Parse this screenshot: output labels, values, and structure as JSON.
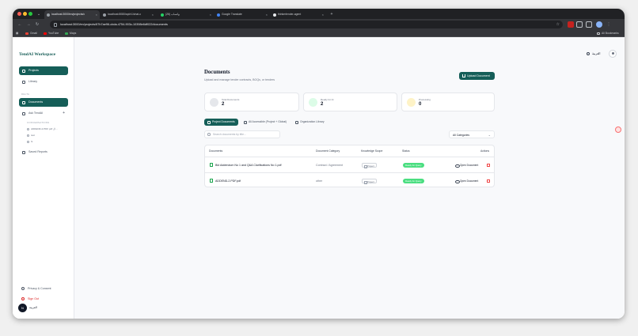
{
  "browser": {
    "tabs": [
      {
        "label": "localhost:3000/en/projects/c"
      },
      {
        "label": "localhost:8080/api/v1/chat-c"
      },
      {
        "label": "(26) واتساب"
      },
      {
        "label": "Google Translate"
      },
      {
        "label": "thinkerlender-agent"
      }
    ],
    "url": "localhost:3000/en/projects/67b7ae96-cbda-4754-903c-10398e6df022/documents",
    "ask_gemini": "Ask Gemini",
    "bookmarks": [
      {
        "label": "Gmail"
      },
      {
        "label": "YouTube"
      },
      {
        "label": "Maps"
      }
    ],
    "all_bookmarks": "All Bookmarks"
  },
  "app": {
    "brand": "TendAI Workspace",
    "nav": {
      "projects": "Projects",
      "library": "Library",
      "section_label": "DELTA",
      "documents": "Documents",
      "ask": "Ask TendAI",
      "conversations_label": "CONVERSATIONS",
      "conversations": [
        "ADDEND-2.PDF pdf ال...",
        "test",
        "hi"
      ],
      "saved_reports": "Saved Reports"
    },
    "footer": {
      "privacy": "Privacy & Consent",
      "sign_out": "Sign Out",
      "user_initial": "N",
      "user_name": "العربية"
    },
    "language": "العربية"
  },
  "main": {
    "title": "Documents",
    "subtitle": "Upload and manage tender contracts, BOQs, or tenders",
    "upload_label": "Upload Document",
    "stats": [
      {
        "label": "Total Documents",
        "value": "2"
      },
      {
        "label": "Ready for AI",
        "value": "2"
      },
      {
        "label": "Processing",
        "value": "0"
      }
    ],
    "filters": [
      {
        "label": "Project Documents"
      },
      {
        "label": "All Accessible (Project + Global)"
      },
      {
        "label": "Organization Library"
      }
    ],
    "search_placeholder": "Search documents by title...",
    "category_select": "All Categories",
    "table": {
      "headers": [
        "Documents",
        "Document Category",
        "Knowledge Scope",
        "Status",
        "Actions"
      ],
      "rows": [
        {
          "name": "Bid Addendum No 1 and Q&A Clarifications No 1.pdf",
          "category": "Contract / Agreement",
          "scope": "Project",
          "status": "Ready for Query",
          "action": "Open Document"
        },
        {
          "name": "ADDEND-2.PDF.pdf",
          "category": "other",
          "scope": "Project",
          "status": "Ready for Query",
          "action": "Open Document"
        }
      ]
    }
  },
  "colors": {
    "accent": "#155e58",
    "status_ready": "#4ade80",
    "danger": "#dc2626"
  }
}
